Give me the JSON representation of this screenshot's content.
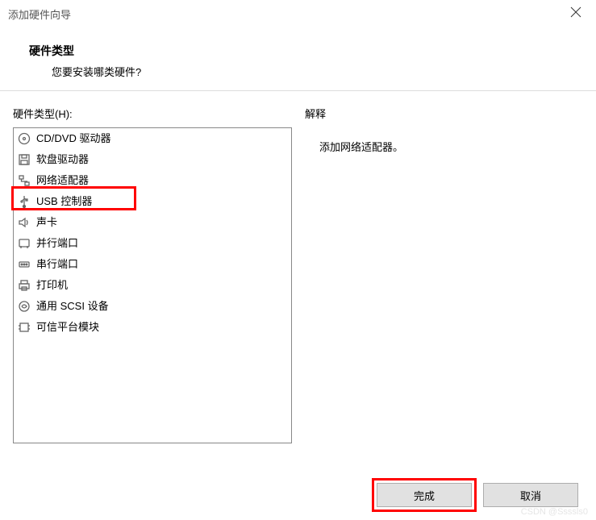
{
  "window": {
    "title": "添加硬件向导"
  },
  "header": {
    "heading": "硬件类型",
    "subheading": "您要安装哪类硬件?"
  },
  "left": {
    "label": "硬件类型(H):",
    "items": [
      {
        "label": "CD/DVD 驱动器",
        "icon": "disc-icon"
      },
      {
        "label": "软盘驱动器",
        "icon": "floppy-icon"
      },
      {
        "label": "网络适配器",
        "icon": "network-icon"
      },
      {
        "label": "USB 控制器",
        "icon": "usb-icon"
      },
      {
        "label": "声卡",
        "icon": "sound-icon"
      },
      {
        "label": "并行端口",
        "icon": "parallel-port-icon"
      },
      {
        "label": "串行端口",
        "icon": "serial-port-icon"
      },
      {
        "label": "打印机",
        "icon": "printer-icon"
      },
      {
        "label": "通用 SCSI 设备",
        "icon": "scsi-icon"
      },
      {
        "label": "可信平台模块",
        "icon": "tpm-icon"
      }
    ]
  },
  "right": {
    "label": "解释",
    "description": "添加网络适配器。"
  },
  "buttons": {
    "finish": "完成",
    "cancel": "取消"
  },
  "watermark": "CSDN @Ssssls0"
}
